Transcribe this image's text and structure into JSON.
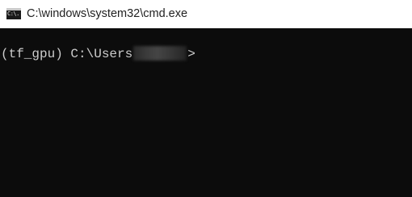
{
  "window": {
    "title": "C:\\windows\\system32\\cmd.exe",
    "icon": "cmd-app-icon",
    "icon_glyph": "C:\\."
  },
  "console": {
    "prompt_prefix": "(tf_gpu) C:\\Users",
    "prompt_suffix": ">",
    "username_redacted": true
  },
  "colors": {
    "console_background": "#0c0c0c",
    "console_text": "#cccccc",
    "titlebar_background": "#ffffff"
  }
}
